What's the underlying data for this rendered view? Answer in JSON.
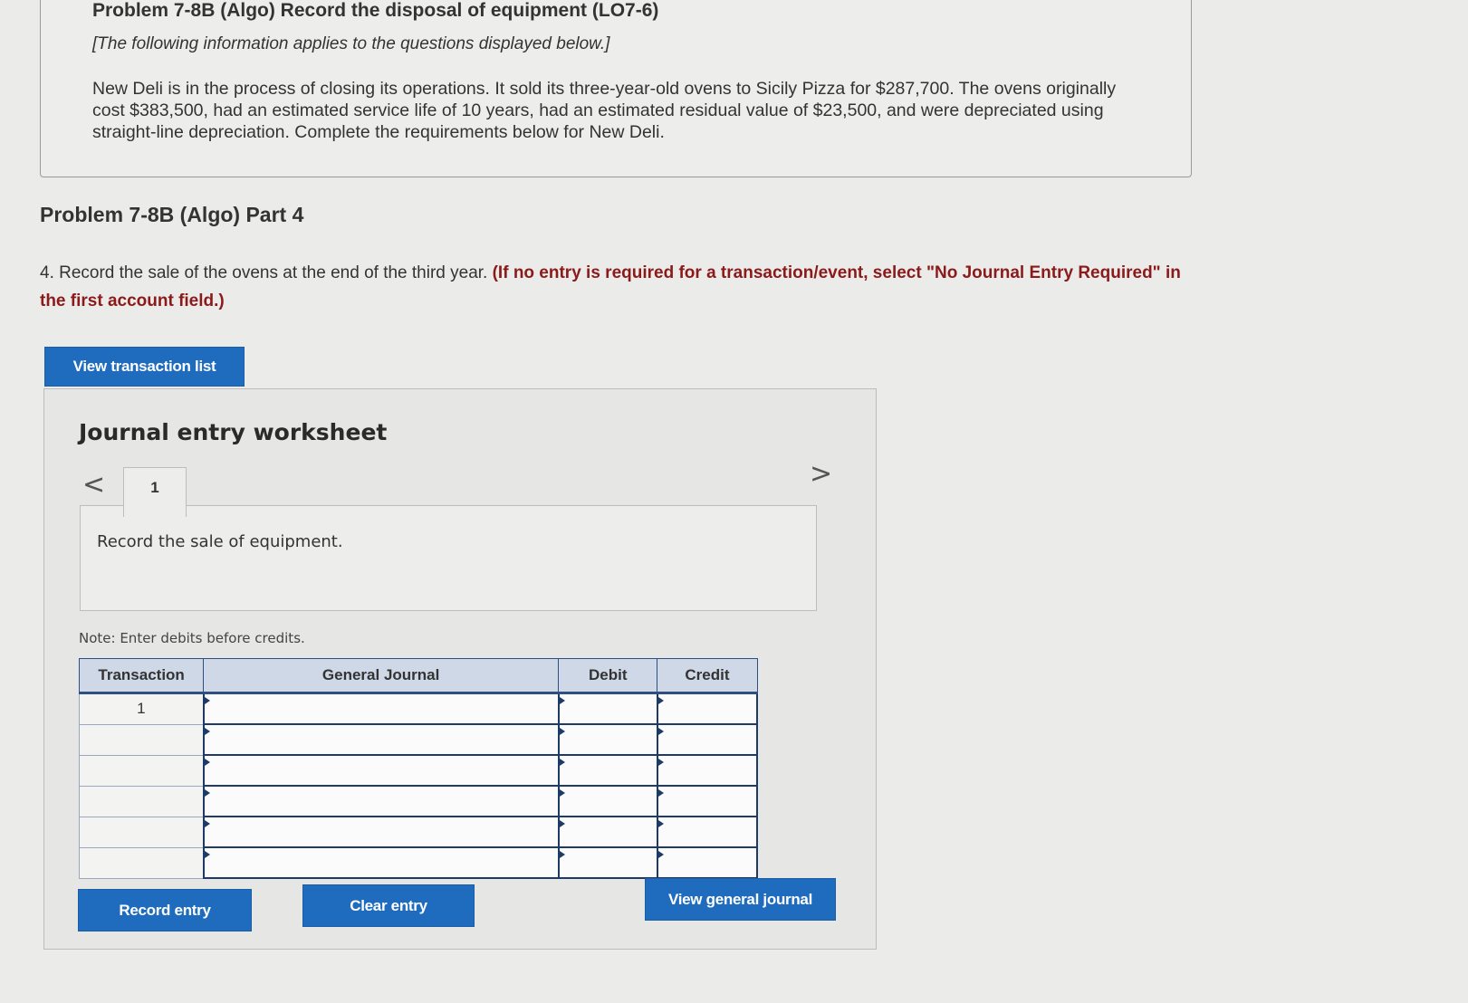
{
  "info": {
    "title": "Problem 7-8B (Algo) Record the disposal of equipment (LO7-6)",
    "subtitle": "[The following information applies to the questions displayed below.]",
    "text": "New Deli is in the process of closing its operations. It sold its three-year-old ovens to Sicily Pizza for $287,700. The ovens originally cost $383,500, had an estimated service life of 10 years, had an estimated residual value of $23,500, and were depreciated using straight-line depreciation. Complete the requirements below for New Deli."
  },
  "part_title": "Problem 7-8B (Algo) Part 4",
  "question": {
    "text": "4. Record the sale of the ovens at the end of the third year.",
    "instruction": "(If no entry is required for a transaction/event, select \"No Journal Entry Required\" in the first account field.)"
  },
  "buttons": {
    "view_transaction_list": "View transaction list",
    "record_entry": "Record entry",
    "clear_entry": "Clear entry",
    "view_general_journal": "View general journal"
  },
  "worksheet": {
    "title": "Journal entry worksheet",
    "tab_label": "1",
    "description": "Record the sale of equipment.",
    "note": "Note: Enter debits before credits.",
    "nav_prev": "<",
    "nav_next": ">"
  },
  "journal_table": {
    "headers": [
      "Transaction",
      "General Journal",
      "Debit",
      "Credit"
    ],
    "rows": [
      {
        "transaction": "1",
        "account": "",
        "debit": "",
        "credit": ""
      },
      {
        "transaction": "",
        "account": "",
        "debit": "",
        "credit": ""
      },
      {
        "transaction": "",
        "account": "",
        "debit": "",
        "credit": ""
      },
      {
        "transaction": "",
        "account": "",
        "debit": "",
        "credit": ""
      },
      {
        "transaction": "",
        "account": "",
        "debit": "",
        "credit": ""
      },
      {
        "transaction": "",
        "account": "",
        "debit": "",
        "credit": ""
      }
    ]
  },
  "colors": {
    "button_blue": "#1f6cbf",
    "instruction_red": "#8b1a1a",
    "table_header_bg": "#cfd8e6"
  }
}
